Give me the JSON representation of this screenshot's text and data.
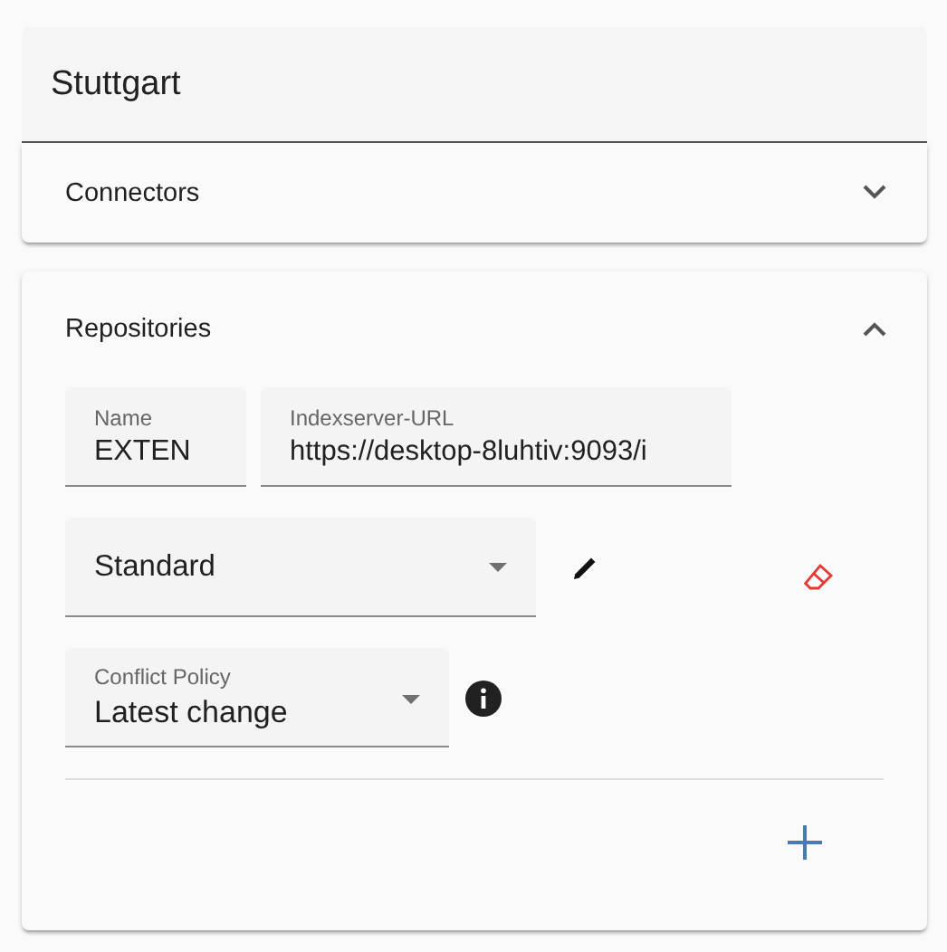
{
  "header": {
    "title": "Stuttgart"
  },
  "panels": [
    {
      "title": "Connectors",
      "expanded": false
    },
    {
      "title": "Repositories",
      "expanded": true,
      "name_field": {
        "label": "Name",
        "value": "EXTEN"
      },
      "url_field": {
        "label": "Indexserver-URL",
        "value": "https://desktop-8luhtiv:9093/i"
      },
      "profile_select": {
        "value": "Standard"
      },
      "conflict_select": {
        "label": "Conflict Policy",
        "value": "Latest change"
      }
    }
  ]
}
